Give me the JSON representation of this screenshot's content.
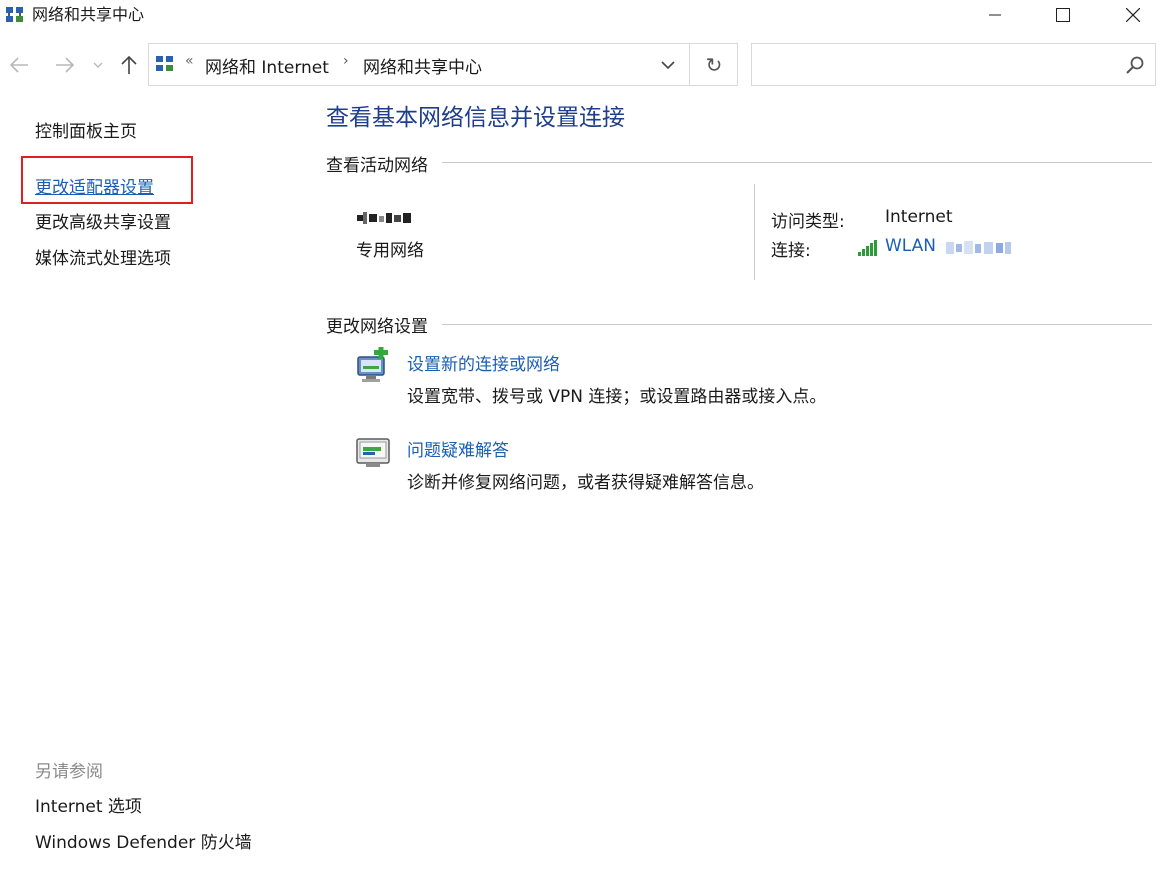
{
  "window": {
    "title": "网络和共享中心",
    "icon": "network-center-icon"
  },
  "address_bar": {
    "chevron": "«",
    "breadcrumbs": [
      "网络和 Internet",
      "网络和共享中心"
    ],
    "separator": "›",
    "refresh_glyph": "↻"
  },
  "search": {
    "placeholder": ""
  },
  "left_pane": {
    "items": [
      "控制面板主页",
      "更改适配器设置",
      "更改高级共享设置",
      "媒体流式处理选项"
    ],
    "see_also_title": "另请参阅",
    "see_also": [
      "Internet 选项",
      "Windows Defender 防火墙"
    ]
  },
  "main": {
    "title": "查看基本网络信息并设置连接",
    "active_section": "查看活动网络",
    "network": {
      "type": "专用网络",
      "access_label": "访问类型:",
      "access_value": "Internet",
      "connection_label": "连接:",
      "connection_value": "WLAN"
    },
    "change_section": "更改网络设置",
    "tasks": [
      {
        "link": "设置新的连接或网络",
        "desc": "设置宽带、拨号或 VPN 连接；或设置路由器或接入点。",
        "icon": "new-connection-icon"
      },
      {
        "link": "问题疑难解答",
        "desc": "诊断并修复网络问题，或者获得疑难解答信息。",
        "icon": "troubleshoot-icon"
      }
    ]
  },
  "colors": {
    "link": "#1a5fb4",
    "title": "#1e3e8c",
    "highlight": "#e02020",
    "muted": "#8a8a8a"
  }
}
